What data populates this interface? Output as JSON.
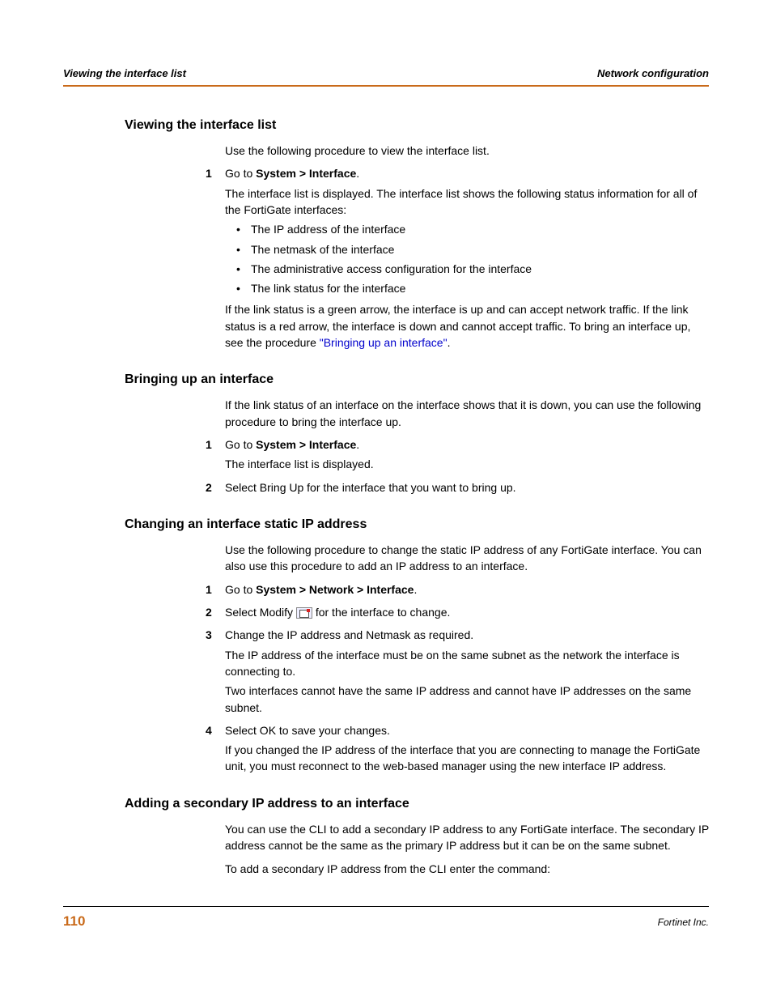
{
  "header": {
    "left": "Viewing the interface list",
    "right": "Network configuration"
  },
  "sections": {
    "s1": {
      "title": "Viewing the interface list",
      "intro": "Use the following procedure to view the interface list.",
      "step1_num": "1",
      "step1_goto_pre": "Go to ",
      "step1_goto_bold": "System > Interface",
      "step1_goto_post": ".",
      "step1_desc": "The interface list is displayed. The interface list shows the following status information for all of the FortiGate interfaces:",
      "bullet1": "The IP address of the interface",
      "bullet2": "The netmask of the interface",
      "bullet3": "The administrative access configuration for the interface",
      "bullet4": "The link status for the interface",
      "link_pre": "If the link status is a green arrow, the interface is up and can accept network traffic. If the link status is a red arrow, the interface is down and cannot accept traffic. To bring an interface up, see the procedure ",
      "link_text": "\"Bringing up an interface\"",
      "link_post": "."
    },
    "s2": {
      "title": "Bringing up an interface",
      "intro": "If the link status of an interface on the interface shows that it is down, you can use the following procedure to bring the interface up.",
      "step1_num": "1",
      "step1_goto_pre": "Go to ",
      "step1_goto_bold": "System > Interface",
      "step1_goto_post": ".",
      "step1_desc": "The interface list is displayed.",
      "step2_num": "2",
      "step2_text": "Select Bring Up for the interface that you want to bring up."
    },
    "s3": {
      "title": "Changing an interface static IP address",
      "intro": "Use the following procedure to change the static IP address of any FortiGate interface. You can also use this procedure to add an IP address to an interface.",
      "step1_num": "1",
      "step1_goto_pre": "Go to ",
      "step1_goto_bold": "System > Network > Interface",
      "step1_goto_post": ".",
      "step2_num": "2",
      "step2_pre": "Select Modify ",
      "step2_post": " for the interface to change.",
      "step3_num": "3",
      "step3_line": "Change the IP address and Netmask as required.",
      "step3_p1": "The IP address of the interface must be on the same subnet as the network the interface is connecting to.",
      "step3_p2": "Two interfaces cannot have the same IP address and cannot have IP addresses on the same subnet.",
      "step4_num": "4",
      "step4_line": "Select OK to save your changes.",
      "step4_p1": "If you changed the IP address of the interface that you are connecting to manage the FortiGate unit, you must reconnect to the web-based manager using the new interface IP address."
    },
    "s4": {
      "title": "Adding a secondary IP address to an interface",
      "p1": "You can use the CLI to add a secondary IP address to any FortiGate interface. The secondary IP address cannot be the same as the primary IP address but it can be on the same subnet.",
      "p2": "To add a secondary IP address from the CLI enter the command:"
    }
  },
  "footer": {
    "page": "110",
    "company": "Fortinet Inc."
  }
}
